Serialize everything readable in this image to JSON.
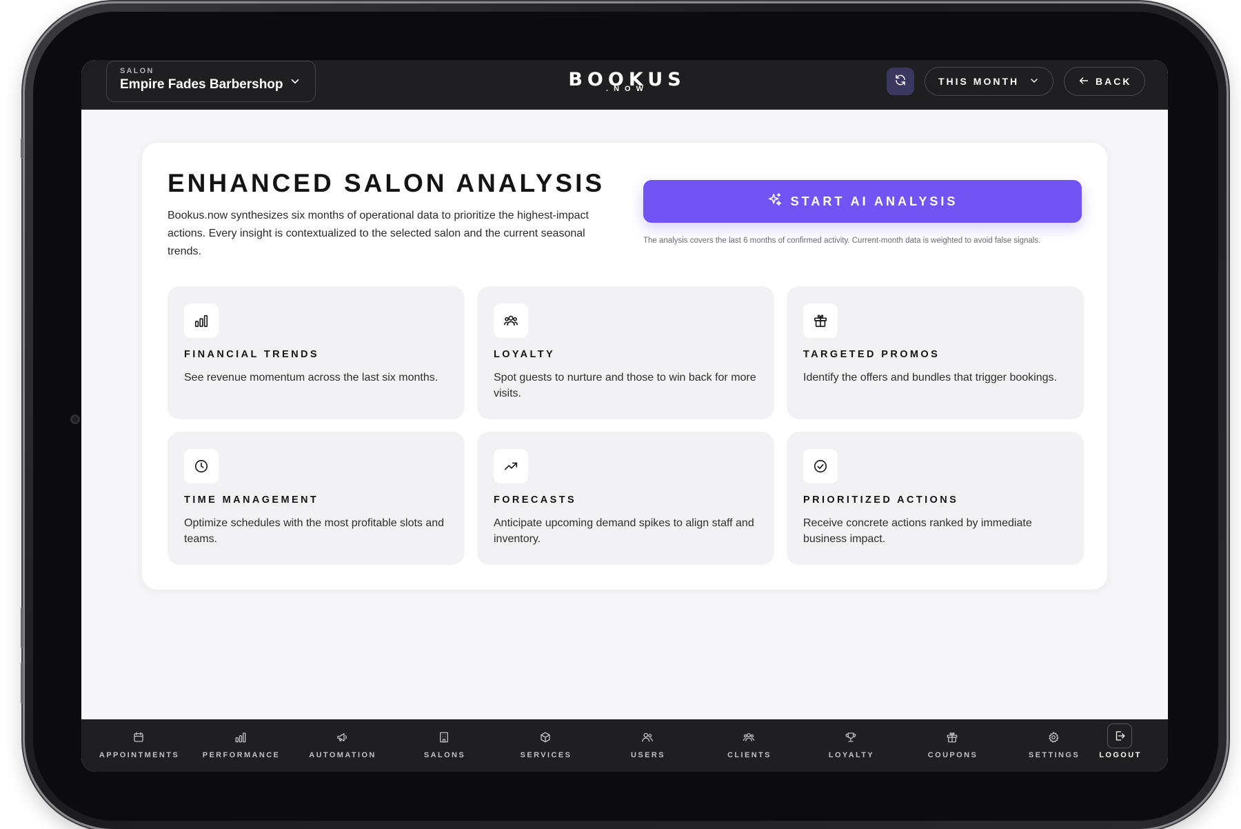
{
  "topbar": {
    "salon_kicker": "SALON",
    "salon_name": "Empire Fades Barbershop",
    "logo_main": "BOOKUS",
    "logo_sub": ".NOW",
    "period_label": "THIS MONTH",
    "back_label": "BACK"
  },
  "main": {
    "title": "ENHANCED SALON ANALYSIS",
    "description": "Bookus.now synthesizes six months of operational data to prioritize the highest-impact actions. Every insight is contextualized to the selected salon and the current seasonal trends.",
    "ai_button_label": "START AI ANALYSIS",
    "ai_note": "The analysis covers the last 6 months of confirmed activity. Current-month data is weighted to avoid false signals.",
    "tiles": [
      {
        "icon": "bar-chart-icon",
        "title": "FINANCIAL TRENDS",
        "description": "See revenue momentum across the last six months."
      },
      {
        "icon": "users-group-icon",
        "title": "LOYALTY",
        "description": "Spot guests to nurture and those to win back for more visits."
      },
      {
        "icon": "gift-icon",
        "title": "TARGETED PROMOS",
        "description": "Identify the offers and bundles that trigger bookings."
      },
      {
        "icon": "clock-icon",
        "title": "TIME MANAGEMENT",
        "description": "Optimize schedules with the most profitable slots and teams."
      },
      {
        "icon": "trending-up-icon",
        "title": "FORECASTS",
        "description": "Anticipate upcoming demand spikes to align staff and inventory."
      },
      {
        "icon": "check-circle-icon",
        "title": "PRIORITIZED ACTIONS",
        "description": "Receive concrete actions ranked by immediate business impact."
      }
    ]
  },
  "bottomnav": {
    "items": [
      {
        "icon": "calendar-icon",
        "label": "APPOINTMENTS"
      },
      {
        "icon": "bar-chart-icon",
        "label": "PERFORMANCE"
      },
      {
        "icon": "megaphone-icon",
        "label": "AUTOMATION"
      },
      {
        "icon": "building-icon",
        "label": "SALONS"
      },
      {
        "icon": "box-icon",
        "label": "SERVICES"
      },
      {
        "icon": "users-icon",
        "label": "USERS"
      },
      {
        "icon": "users-group-icon",
        "label": "CLIENTS"
      },
      {
        "icon": "trophy-icon",
        "label": "LOYALTY"
      },
      {
        "icon": "gift-icon",
        "label": "COUPONS"
      },
      {
        "icon": "gear-icon",
        "label": "SETTINGS"
      },
      {
        "icon": "logout-icon",
        "label": "LOGOUT"
      }
    ]
  },
  "colors": {
    "accent": "#7254f5",
    "topbar": "#1f1f22",
    "screen_bg": "#f6f6f8"
  }
}
